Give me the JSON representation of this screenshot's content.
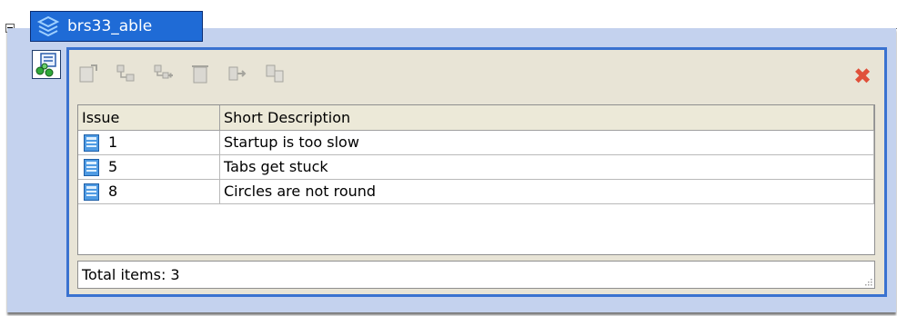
{
  "node": {
    "title": "brs33_able",
    "tab_icon": "layers-icon",
    "node_icon": "workflow-node-icon"
  },
  "toolbar": {
    "icons": [
      "new-record-icon",
      "link-records-icon",
      "add-linked-icon",
      "delete-icon",
      "move-icon",
      "copy-icon"
    ],
    "close_icon": "close-icon",
    "close_glyph": "✖"
  },
  "table": {
    "columns": [
      "Issue",
      "Short Description"
    ],
    "rows": [
      {
        "issue": "1",
        "description": "Startup is too slow"
      },
      {
        "issue": "5",
        "description": "Tabs get stuck"
      },
      {
        "issue": "8",
        "description": "Circles are not round"
      }
    ]
  },
  "status": {
    "total_items": "Total items: 3"
  },
  "colors": {
    "tab_blue": "#1f6bd6",
    "panel_border": "#3a72d0",
    "group_bg": "#c4d2ee",
    "close_red": "#e0503a"
  }
}
